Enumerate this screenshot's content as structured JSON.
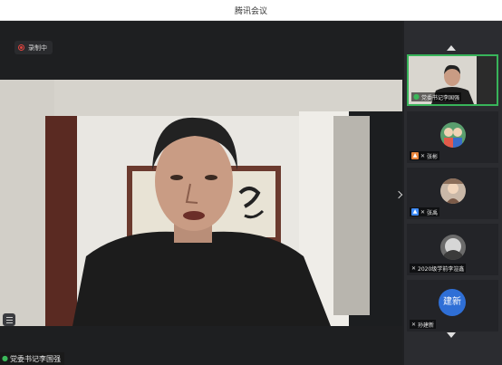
{
  "window": {
    "title": "腾讯会议"
  },
  "recording": {
    "label": "录制中"
  },
  "main_speaker": {
    "name": "党委书记李国强"
  },
  "participants": [
    {
      "name": "党委书记李国强",
      "active": true
    },
    {
      "name": "张彬",
      "active": false
    },
    {
      "name": "张禹",
      "active": false
    },
    {
      "name": "2020级学前李渲鑫",
      "active": false
    },
    {
      "name": "孙建新",
      "avatar_text": "建新",
      "active": false
    }
  ],
  "colors": {
    "active_border": "#38b45a",
    "record_red": "#e0443e",
    "avatar_blue": "#2f6fd6"
  }
}
